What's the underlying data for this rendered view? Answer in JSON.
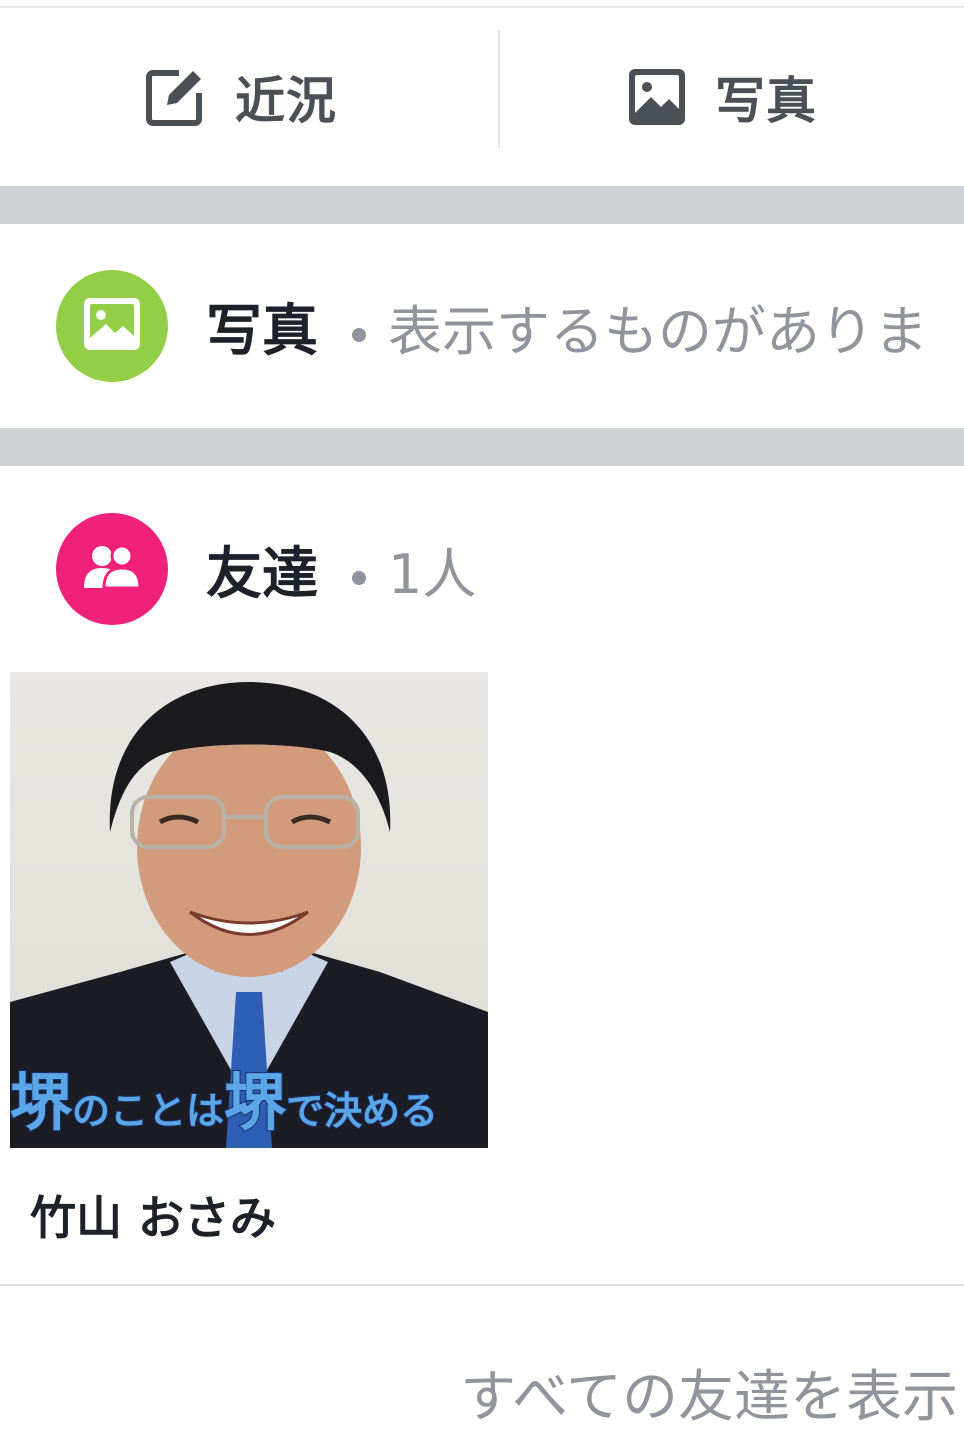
{
  "action_bar": {
    "status_label": "近況",
    "photo_label": "写真"
  },
  "photos_section": {
    "title": "写真",
    "subtitle": "表示するものがありま"
  },
  "friends_section": {
    "title": "友達",
    "count": "1人"
  },
  "friend_card": {
    "name": "竹山 おさみ",
    "caption_big_1": "堺",
    "caption_small_1": "のことは",
    "caption_big_2": "堺",
    "caption_small_2": "で決める"
  },
  "footer": {
    "see_all": "すべての友達を表示"
  },
  "colors": {
    "photos_icon_bg": "#93cf46",
    "friends_icon_bg": "#f0217a",
    "section_band": "#d0d1d5",
    "muted_text": "#90949c"
  },
  "icons": {
    "status": "edit-icon",
    "photo": "image-icon",
    "friends": "people-icon"
  }
}
